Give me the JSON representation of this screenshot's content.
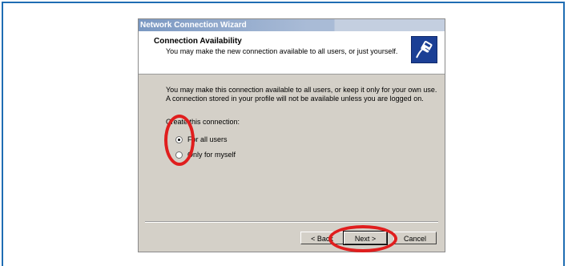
{
  "window": {
    "title": "Network Connection Wizard"
  },
  "header": {
    "title": "Connection Availability",
    "subtitle": "You may make the new connection available to all users, or just yourself.",
    "icon": "network-cable-icon"
  },
  "body": {
    "description": "You may make this connection available to all users, or keep it only for your own use. A connection stored in your profile will not be available unless you are logged on.",
    "group_label": "Create this connection:",
    "options": [
      {
        "label": "For all users",
        "selected": true
      },
      {
        "label": "Only for myself",
        "selected": false
      }
    ]
  },
  "buttons": {
    "back": "< Back",
    "next": "Next >",
    "cancel": "Cancel"
  },
  "colors": {
    "annotation": "#e01e1e",
    "frame": "#1f6db3",
    "dialog": "#d4d0c8"
  }
}
